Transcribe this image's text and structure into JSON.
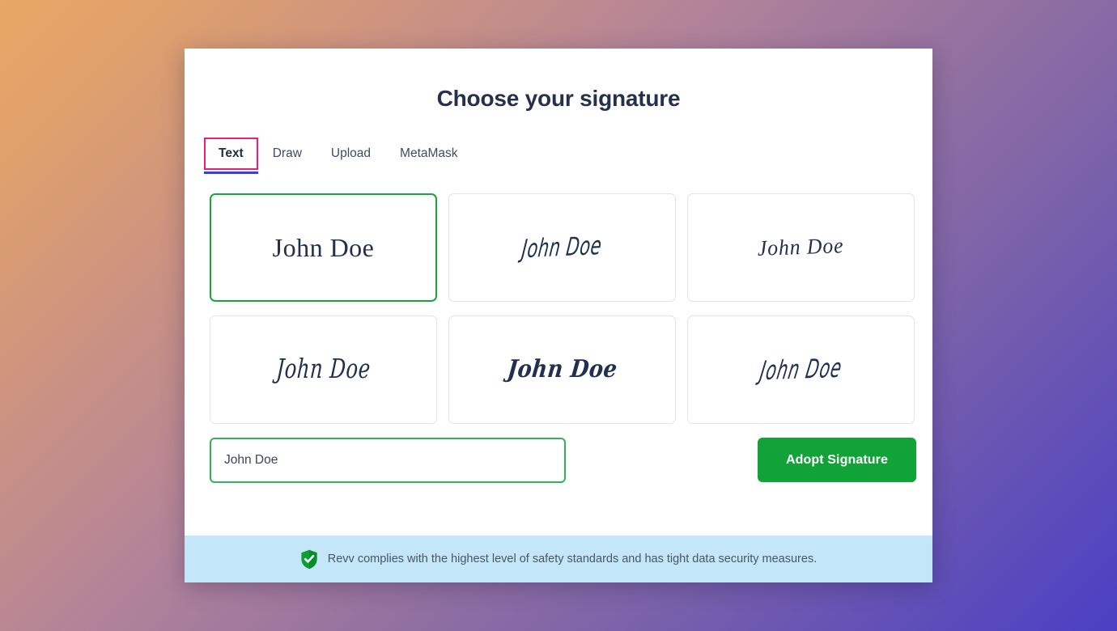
{
  "background": {
    "gradient_from": "#e9a765",
    "gradient_to": "#4b3fc4"
  },
  "modal": {
    "title": "Choose your signature",
    "accent_selected": "#17a63a",
    "accent_focus_ring": "#ec1e79",
    "accent_underline": "#3b3fc9"
  },
  "tabs": [
    {
      "label": "Text",
      "active": true
    },
    {
      "label": "Draw",
      "active": false
    },
    {
      "label": "Upload",
      "active": false
    },
    {
      "label": "MetaMask",
      "active": false
    }
  ],
  "signatures": [
    {
      "text": "John Doe",
      "style": "serif",
      "selected": true
    },
    {
      "text": "John Doe",
      "style": "hand1",
      "selected": false
    },
    {
      "text": "John Doe",
      "style": "hand2",
      "selected": false
    },
    {
      "text": "John Doe",
      "style": "script-thin",
      "selected": false
    },
    {
      "text": "John Doe",
      "style": "script-bold",
      "selected": false
    },
    {
      "text": "John Doe",
      "style": "brush",
      "selected": false
    }
  ],
  "name_field": {
    "value": "John Doe",
    "placeholder": "Your name",
    "border_color": "#36b15a"
  },
  "adopt_button": {
    "label": "Adopt Signature",
    "color": "#12a338"
  },
  "footer": {
    "icon": "shield-check-icon",
    "icon_color": "#17a63a",
    "background": "#c3e7f8",
    "text": "Revv complies with the highest level of safety standards and has tight data security measures."
  }
}
